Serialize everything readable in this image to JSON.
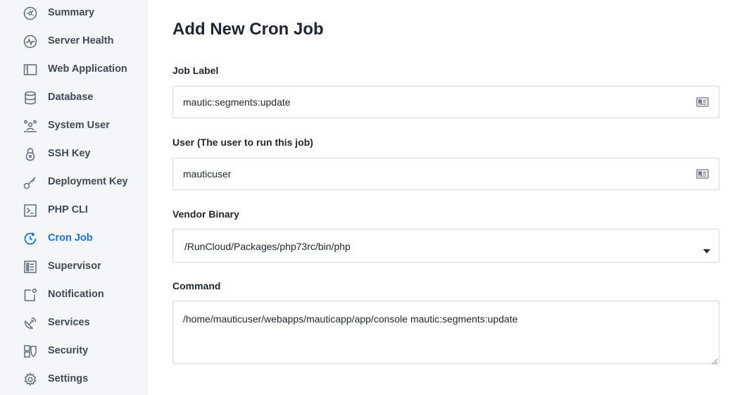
{
  "sidebar": {
    "items": [
      {
        "label": "Summary",
        "icon": "dashboard-icon"
      },
      {
        "label": "Server Health",
        "icon": "pulse-icon"
      },
      {
        "label": "Web Application",
        "icon": "layout-icon"
      },
      {
        "label": "Database",
        "icon": "database-icon"
      },
      {
        "label": "System User",
        "icon": "users-icon"
      },
      {
        "label": "SSH Key",
        "icon": "lock-icon"
      },
      {
        "label": "Deployment Key",
        "icon": "key-icon"
      },
      {
        "label": "PHP CLI",
        "icon": "terminal-icon"
      },
      {
        "label": "Cron Job",
        "icon": "refresh-icon",
        "active": true
      },
      {
        "label": "Supervisor",
        "icon": "checklist-icon"
      },
      {
        "label": "Notification",
        "icon": "notification-icon"
      },
      {
        "label": "Services",
        "icon": "satellite-icon"
      },
      {
        "label": "Security",
        "icon": "shield-icon"
      },
      {
        "label": "Settings",
        "icon": "gear-icon"
      }
    ]
  },
  "form": {
    "title": "Add New Cron Job",
    "job_label": {
      "label": "Job Label",
      "value": "mautic:segments:update"
    },
    "user": {
      "label": "User (The user to run this job)",
      "value": "mauticuser"
    },
    "vendor_binary": {
      "label": "Vendor Binary",
      "value": "/RunCloud/Packages/php73rc/bin/php"
    },
    "command": {
      "label": "Command",
      "value": "/home/mauticuser/webapps/mauticapp/app/console mautic:segments:update"
    }
  },
  "colors": {
    "accent": "#1473e6",
    "sidebar_bg": "#f4f6fa",
    "nav_text": "#3f4a59",
    "icon": "#5f6b7a",
    "border": "#d6dbe2"
  }
}
